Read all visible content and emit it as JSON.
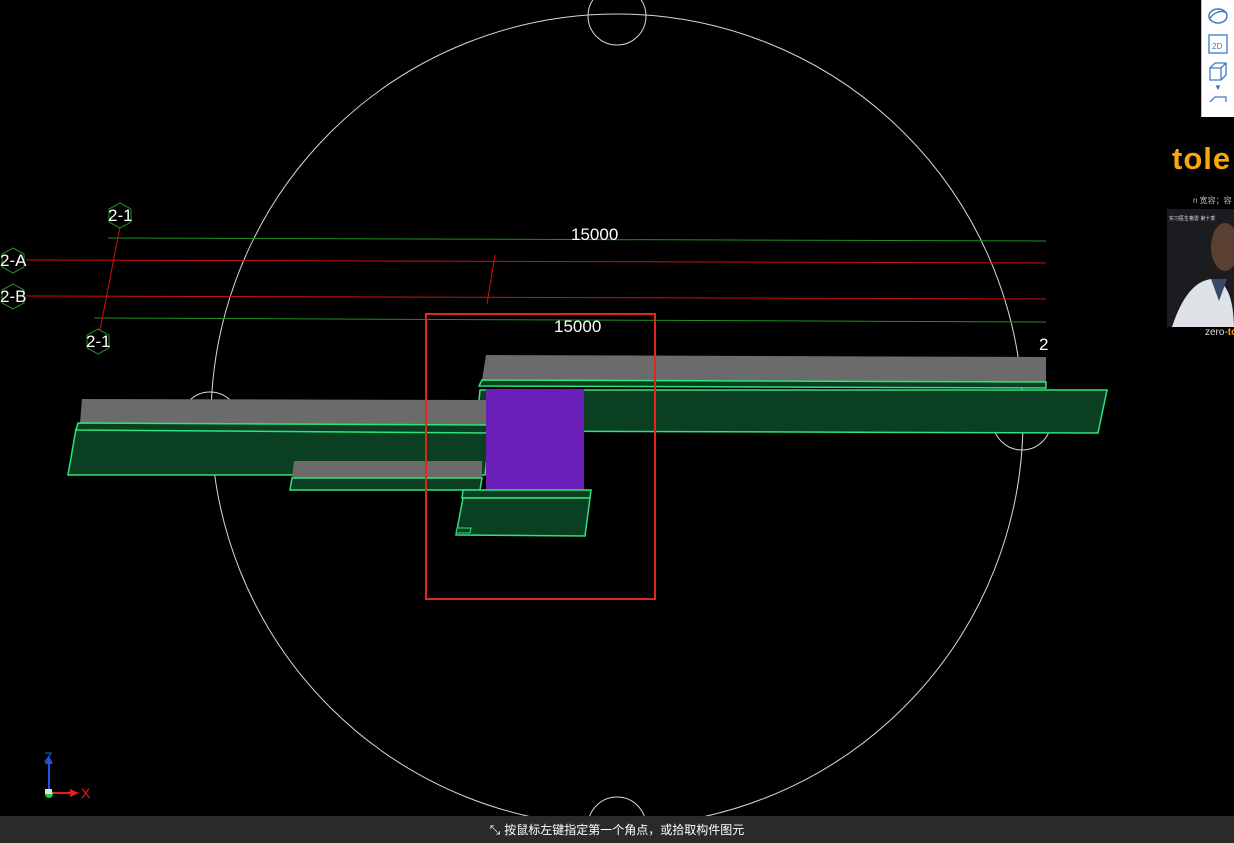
{
  "viewport": {
    "axis_labels": [
      "2-1",
      "2-A",
      "2-B",
      "2-1",
      "2"
    ],
    "dimension_labels": [
      "15000",
      "15000"
    ],
    "triad": {
      "x_label": "X",
      "z_label": "Z"
    },
    "colors": {
      "background": "#000000",
      "grid_green": "#1f8f1f",
      "grid_red": "#cc1111",
      "beam_top": "#6b6b6b",
      "beam_face": "#0a3f22",
      "beam_edge": "#2fe37a",
      "column": "#6a1fb8",
      "selection": "#e0261d",
      "orbit": "#d8d8d8"
    }
  },
  "toolbar": {
    "buttons": [
      {
        "icon": "orbit-icon"
      },
      {
        "icon": "view-2d-icon",
        "label": "2D"
      },
      {
        "icon": "view-3d-cube-icon"
      },
      {
        "icon": "dropdown-caret-icon"
      },
      {
        "icon": "view-cube-partial-icon"
      }
    ]
  },
  "webcam_overlay": {
    "brand": "tole",
    "subtitle": "n  宽容；容",
    "caption_small": "实习医生格雷 第十季",
    "footer_prefix": "zero-",
    "footer_brand": "to"
  },
  "status": {
    "message": "按鼠标左键指定第一个角点，或拾取构件图元"
  }
}
